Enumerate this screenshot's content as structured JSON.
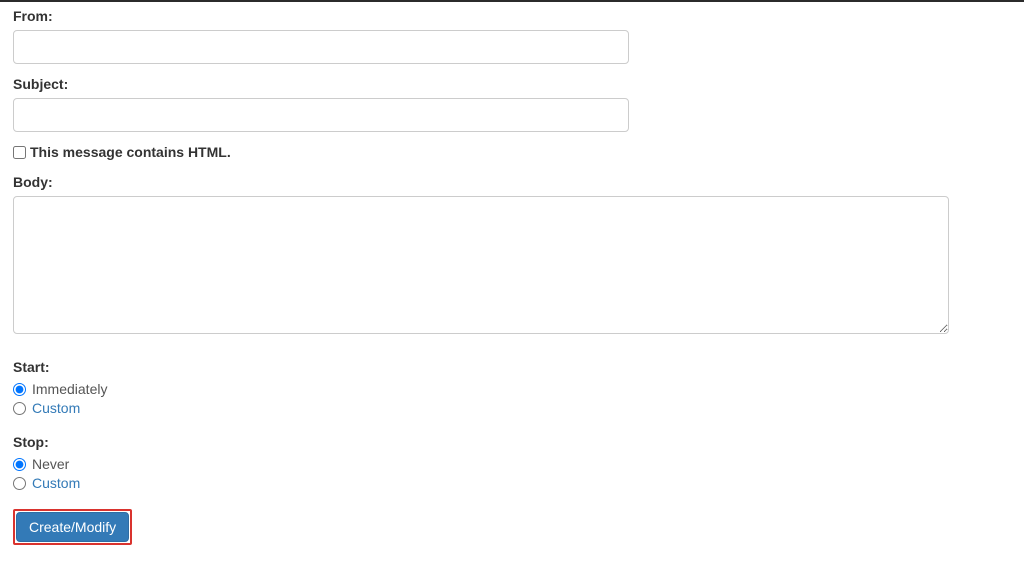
{
  "form": {
    "from": {
      "label": "From:",
      "value": ""
    },
    "subject": {
      "label": "Subject:",
      "value": ""
    },
    "html_checkbox": {
      "label": "This message contains HTML.",
      "checked": false
    },
    "body": {
      "label": "Body:",
      "value": ""
    },
    "start": {
      "label": "Start:",
      "options": {
        "immediately": "Immediately",
        "custom": "Custom"
      },
      "selected": "immediately"
    },
    "stop": {
      "label": "Stop:",
      "options": {
        "never": "Never",
        "custom": "Custom"
      },
      "selected": "never"
    },
    "submit": {
      "label": "Create/Modify"
    }
  }
}
